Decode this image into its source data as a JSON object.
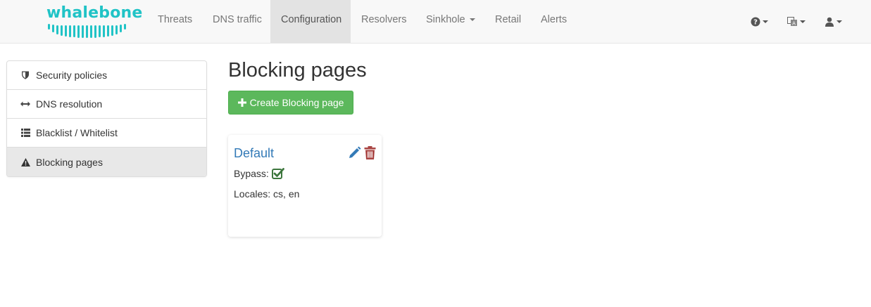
{
  "brand": {
    "name": "whalebone",
    "color": "#20c3c6"
  },
  "nav": {
    "items": [
      {
        "label": "Threats"
      },
      {
        "label": "DNS traffic"
      },
      {
        "label": "Configuration",
        "active": true
      },
      {
        "label": "Resolvers"
      },
      {
        "label": "Sinkhole",
        "dropdown": true
      },
      {
        "label": "Retail"
      },
      {
        "label": "Alerts"
      }
    ],
    "right_icons": [
      "question-circle-icon",
      "language-icon",
      "user-icon"
    ]
  },
  "sidebar": {
    "items": [
      {
        "label": "Security policies",
        "icon": "shield-icon"
      },
      {
        "label": "DNS resolution",
        "icon": "resize-horizontal-icon"
      },
      {
        "label": "Blacklist / Whitelist",
        "icon": "list-icon"
      },
      {
        "label": "Blocking pages",
        "icon": "warning-icon",
        "active": true
      }
    ]
  },
  "main": {
    "title": "Blocking pages",
    "create_button": "Create Blocking page",
    "cards": [
      {
        "name": "Default",
        "bypass_label": "Bypass:",
        "bypass_checked": true,
        "locales_text": "Locales: cs, en"
      }
    ]
  },
  "colors": {
    "link": "#337ab7",
    "success": "#5cb85c",
    "danger": "#a94442",
    "check": "#3c763d"
  }
}
